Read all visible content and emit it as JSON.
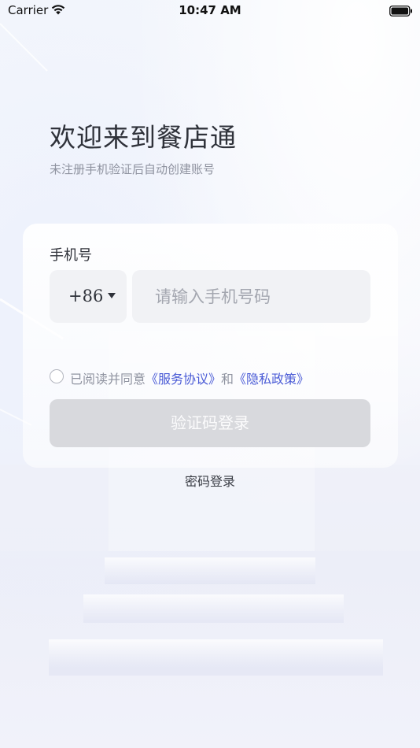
{
  "status_bar": {
    "carrier": "Carrier",
    "time": "10:47 AM"
  },
  "header": {
    "title": "欢迎来到餐店通",
    "subtitle": "未注册手机验证后自动创建账号"
  },
  "form": {
    "phone_label": "手机号",
    "country_code": "+86",
    "phone_value": "",
    "phone_placeholder": "请输入手机号码",
    "agreement_prefix": "已阅读并同意",
    "agreement_service": "《服务协议》",
    "agreement_and": "和",
    "agreement_privacy": "《隐私政策》",
    "agreement_checked": false,
    "login_button": "验证码登录",
    "password_login": "密码登录"
  },
  "icons": {
    "wifi": "wifi-icon",
    "battery": "battery-icon",
    "dropdown": "chevron-down-icon",
    "checkbox": "radio-circle-icon"
  },
  "colors": {
    "link": "#4a5bd6",
    "button_disabled": "#d8d9dd",
    "input_bg": "#f1f2f5",
    "title": "#2f323a",
    "hint": "#8f93a0"
  }
}
